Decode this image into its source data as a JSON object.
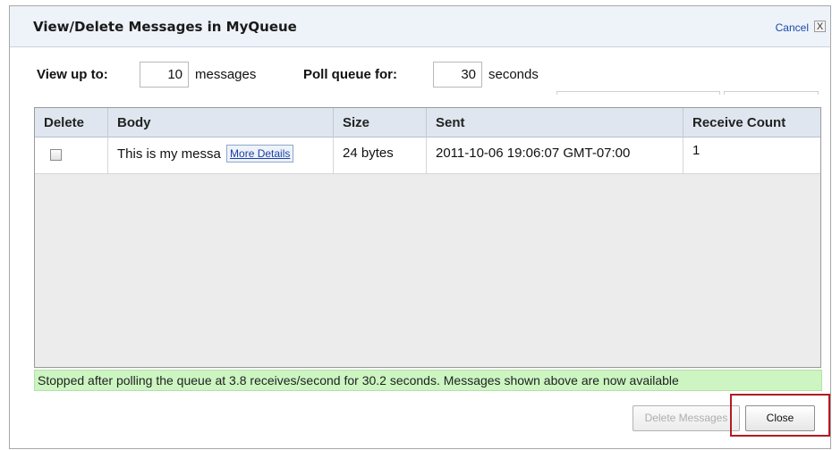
{
  "dialog": {
    "title": "View/Delete Messages in MyQueue",
    "cancel_label": "Cancel",
    "close_x": "X"
  },
  "options": {
    "view_up_to_label": "View up to:",
    "view_up_to_value": "10",
    "view_up_to_suffix": "messages",
    "poll_label": "Poll queue for:",
    "poll_value": "30",
    "poll_suffix": "seconds"
  },
  "table": {
    "columns": [
      "Delete",
      "Body",
      "Size",
      "Sent",
      "Receive Count"
    ],
    "rows": [
      {
        "checked": false,
        "body": "This is my messa",
        "more_details": "More Details",
        "size": "24 bytes",
        "sent": "2011-10-06 19:06:07 GMT-07:00",
        "receive_count": "1"
      }
    ]
  },
  "status": {
    "text": "Stopped after polling the queue at 3.8 receives/second for 30.2 seconds. Messages shown above are now available",
    "color": "#ccf5c2"
  },
  "buttons": {
    "delete_label": "Delete Messages",
    "close_label": "Close"
  },
  "colors": {
    "highlight": "#b31b22",
    "title_bar": "#eef3fa",
    "header_row": "#dfe6ef"
  }
}
